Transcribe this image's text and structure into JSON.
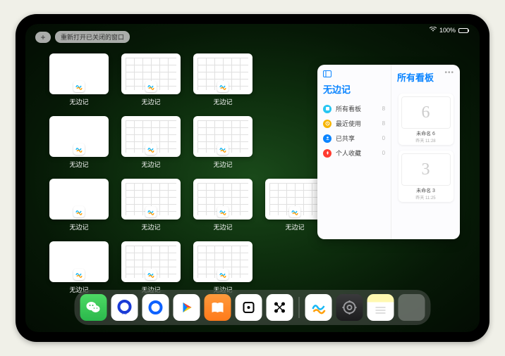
{
  "status": {
    "battery_text": "100%"
  },
  "top": {
    "plus": "+",
    "reopen_label": "重新打开已关闭的窗口"
  },
  "windows": [
    {
      "label": "无边记",
      "content": "blank"
    },
    {
      "label": "无边记",
      "content": "grid"
    },
    {
      "label": "无边记",
      "content": "grid"
    },
    null,
    {
      "label": "无边记",
      "content": "blank"
    },
    {
      "label": "无边记",
      "content": "grid"
    },
    {
      "label": "无边记",
      "content": "grid"
    },
    null,
    {
      "label": "无边记",
      "content": "blank"
    },
    {
      "label": "无边记",
      "content": "grid"
    },
    {
      "label": "无边记",
      "content": "grid"
    },
    {
      "label": "无边记",
      "content": "grid"
    },
    {
      "label": "无边记",
      "content": "blank"
    },
    {
      "label": "无边记",
      "content": "grid"
    },
    {
      "label": "无边记",
      "content": "grid"
    }
  ],
  "panel": {
    "left_title": "无边记",
    "right_title": "所有看板",
    "items": [
      {
        "icon_color": "#27c6f2",
        "label": "所有看板",
        "count": "8"
      },
      {
        "icon_color": "#f7b500",
        "label": "最近使用",
        "count": "8"
      },
      {
        "icon_color": "#0a84ff",
        "label": "已共享",
        "count": "0"
      },
      {
        "icon_color": "#ff3b30",
        "label": "个人收藏",
        "count": "0"
      }
    ],
    "boards": [
      {
        "glyph": "6",
        "name": "未命名 6",
        "sub": "昨天 11:28"
      },
      {
        "glyph": "3",
        "name": "未命名 3",
        "sub": "昨天 11:25"
      }
    ]
  },
  "dock": {
    "icons": [
      {
        "name": "wechat-icon",
        "bg": "linear-gradient(#4dd964,#2bb84c)"
      },
      {
        "name": "quark-hd-icon",
        "bg": "#ffffff"
      },
      {
        "name": "quark-icon",
        "bg": "#ffffff"
      },
      {
        "name": "play-icon",
        "bg": "#ffffff"
      },
      {
        "name": "books-icon",
        "bg": "linear-gradient(#ff9a3c,#ff7a1a)"
      },
      {
        "name": "die-icon",
        "bg": "#ffffff"
      },
      {
        "name": "share-icon",
        "bg": "#ffffff"
      },
      {
        "name": "freeform-icon",
        "bg": "#ffffff"
      },
      {
        "name": "settings-icon",
        "bg": "linear-gradient(#3a3a3c,#1c1c1e)"
      },
      {
        "name": "notes-icon",
        "bg": "linear-gradient(#fff8b0 30%, #ffffff 30%)"
      }
    ],
    "folder": {
      "minis": [
        "#0a84ff",
        "#34c759",
        "#5ac8fa",
        "#ffffff"
      ]
    }
  }
}
